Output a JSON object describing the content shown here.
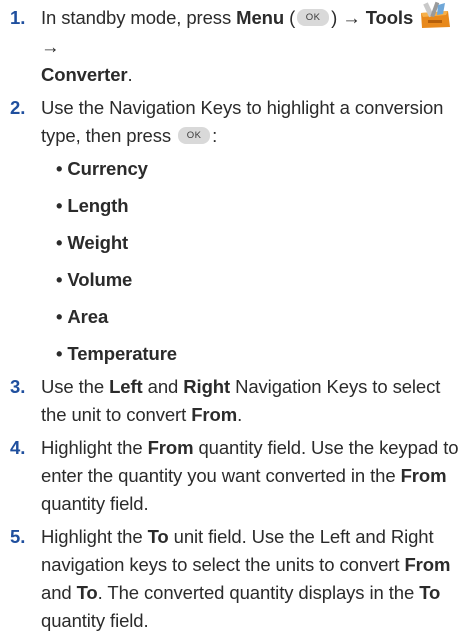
{
  "step1": {
    "number": "1.",
    "text_a": "In standby mode, press ",
    "menu": "Menu",
    "paren_open": " (",
    "ok_key": "OK",
    "paren_close": ") → ",
    "tools": "Tools",
    "arrow": " →",
    "converter": "Converter",
    "period": "."
  },
  "step2": {
    "number": "2.",
    "text_a": "Use the Navigation Keys to highlight a conversion type, then press ",
    "ok_key": "OK",
    "colon": ":",
    "types": [
      "Currency",
      "Length",
      "Weight",
      "Volume",
      "Area",
      "Temperature"
    ]
  },
  "step3": {
    "number": "3.",
    "text_a": "Use the ",
    "left": "Left",
    "and": " and ",
    "right": "Right",
    "text_b": " Navigation Keys to select the unit to convert ",
    "from": "From",
    "period": "."
  },
  "step4": {
    "number": "4.",
    "text_a": "Highlight the ",
    "from": "From",
    "text_b": " quantity field. Use the keypad to enter the quantity you want converted in the ",
    "from2": "From",
    "text_c": " quantity field."
  },
  "step5": {
    "number": "5.",
    "text_a": "Highlight the ",
    "to": "To",
    "text_b": " unit field. Use the Left and Right navigation keys to select the units to convert ",
    "from": "From",
    "and": " and ",
    "to2": "To",
    "text_c": ". The converted quantity displays in the ",
    "to3": "To",
    "text_d": " quantity field."
  }
}
